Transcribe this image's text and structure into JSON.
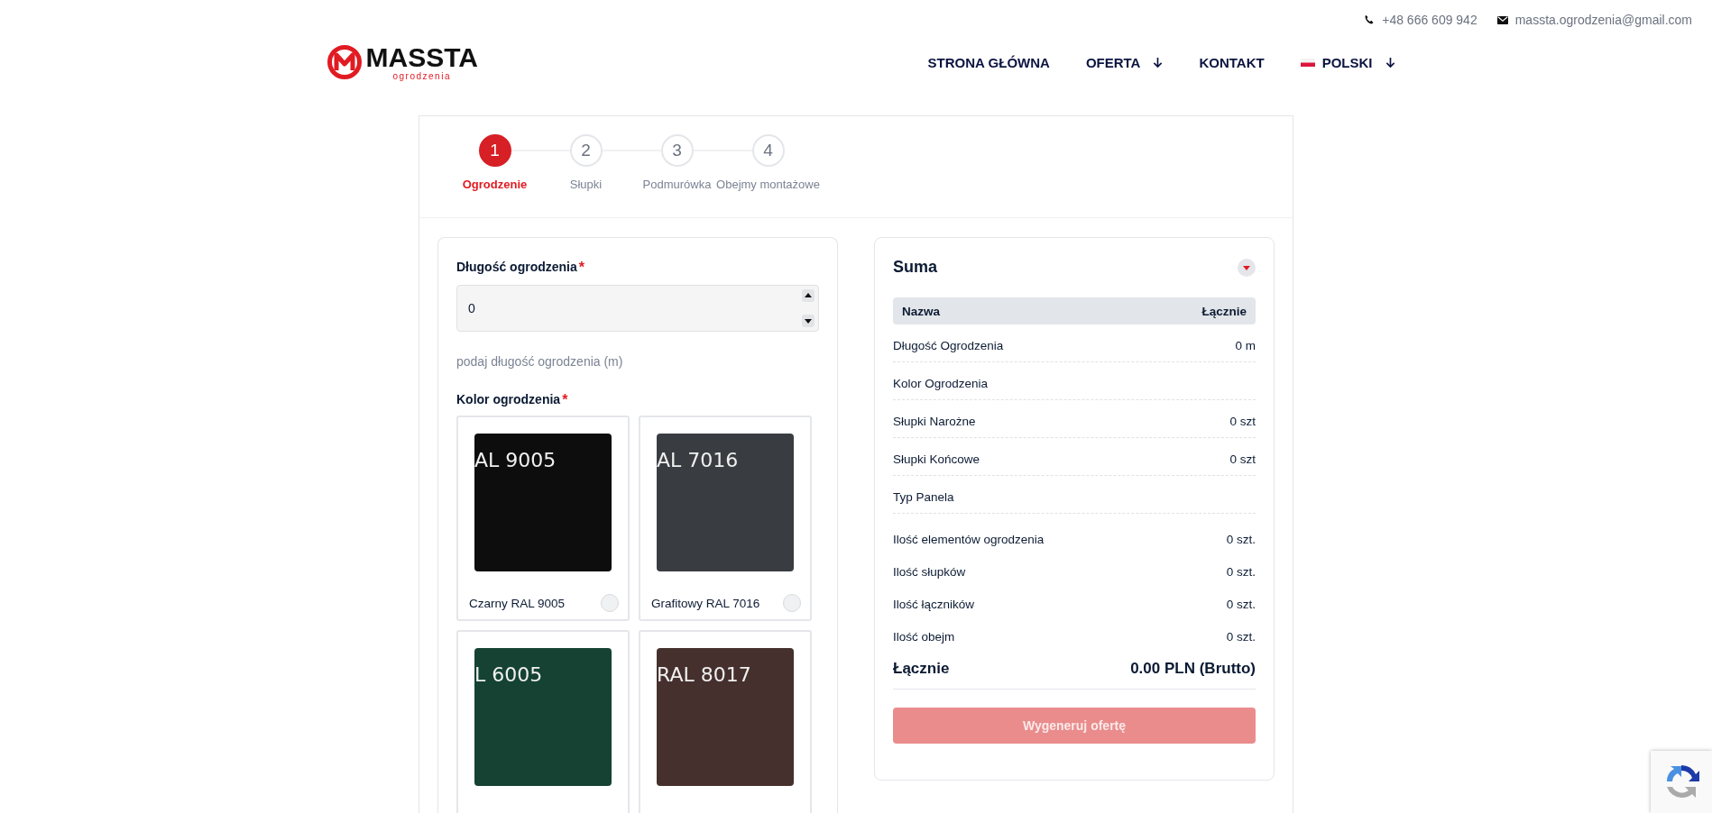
{
  "top_bar": {
    "phone": "+48 666 609 942",
    "email": "massta.ogrodzenia@gmail.com"
  },
  "logo": {
    "name": "MASSTA",
    "tagline": "ogrodzenia"
  },
  "nav": [
    {
      "label": "STRONA GŁÓWNA",
      "dropdown": false,
      "flag": false
    },
    {
      "label": "OFERTA",
      "dropdown": true,
      "flag": false
    },
    {
      "label": "KONTAKT",
      "dropdown": false,
      "flag": false
    },
    {
      "label": "POLSKI",
      "dropdown": true,
      "flag": true
    }
  ],
  "steps": [
    {
      "number": "1",
      "label": "Ogrodzenie",
      "selected": true
    },
    {
      "number": "2",
      "label": "Słupki",
      "selected": false
    },
    {
      "number": "3",
      "label": "Podmurówka",
      "selected": false
    },
    {
      "number": "4",
      "label": "Obejmy montażowe",
      "selected": false
    }
  ],
  "form": {
    "length": {
      "label": "Długość ogrodzenia",
      "required_mark": "*",
      "value": "0",
      "hint": "podaj długość ogrodzenia (m)"
    },
    "color": {
      "label": "Kolor ogrodzenia",
      "required_mark": "*",
      "options": [
        {
          "swatch_text": "AL 9005",
          "color": "#0d0d0d",
          "name": "Czarny RAL 9005",
          "selected": false
        },
        {
          "swatch_text": "AL 7016",
          "color": "#393d41",
          "name": "Grafitowy RAL 7016",
          "selected": false
        },
        {
          "swatch_text": "L 6005",
          "color": "#154233"
        },
        {
          "swatch_text": "RAL 8017",
          "color": "#45302d"
        }
      ]
    }
  },
  "summary": {
    "title": "Suma",
    "columns": [
      "Nazwa",
      "Łącznie"
    ],
    "rows": [
      {
        "name": "Długość Ogrodzenia",
        "value": "0 m"
      },
      {
        "name": "Kolor Ogrodzenia"
      },
      {
        "name": "Słupki Narożne",
        "value": "0 szt"
      },
      {
        "name": "Słupki Końcowe",
        "value": "0 szt"
      },
      {
        "name": "Typ Panela"
      }
    ],
    "counts": [
      {
        "name": "Ilość elementów ogrodzenia",
        "value": "0 szt."
      },
      {
        "name": "Ilość słupków",
        "value": "0 szt."
      },
      {
        "name": "Ilość łączników",
        "value": "0 szt."
      },
      {
        "name": "Ilość obejm",
        "value": "0 szt."
      }
    ],
    "total": {
      "label": "Łącznie",
      "value": "0.00 PLN (Brutto)"
    },
    "button": {
      "label": "Wygeneruj ofertę",
      "disabled": true
    }
  }
}
